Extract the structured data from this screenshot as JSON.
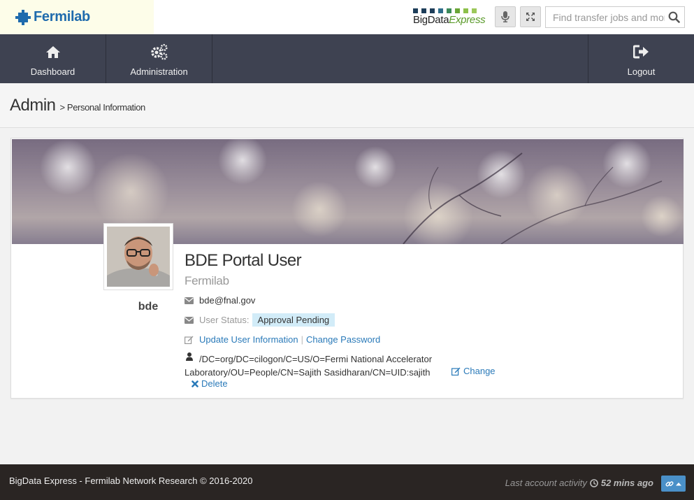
{
  "header": {
    "brand": "Fermilab",
    "product_name_part1": "BigData",
    "product_name_part2": "Express",
    "search_placeholder": "Find transfer jobs and more"
  },
  "nav": {
    "items": [
      {
        "label": "Dashboard",
        "icon": "home-icon"
      },
      {
        "label": "Administration",
        "icon": "gears-icon"
      }
    ],
    "logout_label": "Logout"
  },
  "breadcrumb": {
    "title": "Admin",
    "sub": "> Personal Information"
  },
  "profile": {
    "username": "bde",
    "name": "BDE Portal User",
    "organization": "Fermilab",
    "email": "bde@fnal.gov",
    "status_label": "User Status:",
    "status_value": "Approval Pending",
    "update_link": "Update User Information",
    "change_password_link": "Change Password",
    "dn_line1": "/DC=org/DC=cilogon/C=US/O=Fermi National Accelerator",
    "dn_line2": "Laboratory/OU=People/CN=Sajith Sasidharan/CN=UID:sajith",
    "change_link": "Change",
    "delete_link": "Delete"
  },
  "footer": {
    "copyright": "BigData Express - Fermilab Network Research © 2016-2020",
    "activity_label": "Last account activity",
    "activity_value": "52 mins ago"
  },
  "colors": {
    "brand": "#1f6bad",
    "nav_bg": "#3e4251",
    "link": "#2a7ab9",
    "badge_bg": "#d2ecf8",
    "footer_bg": "#2a2523",
    "footer_button": "#4a90c8"
  }
}
